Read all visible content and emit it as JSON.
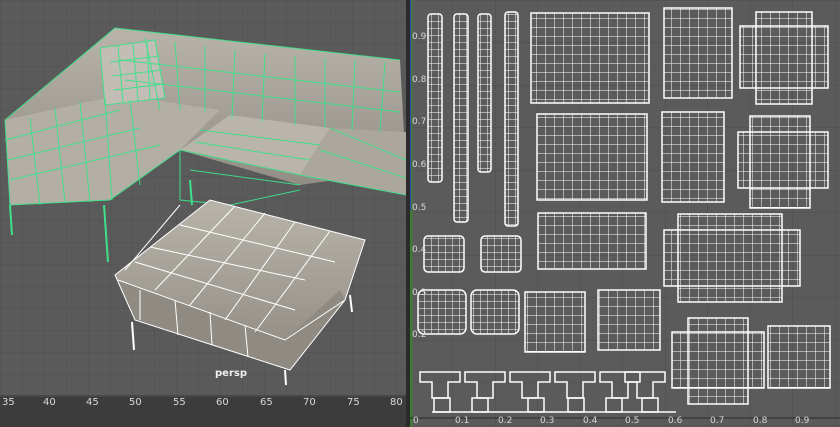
{
  "viewport": {
    "camera_label": "persp",
    "timeline_ticks": [
      "35",
      "40",
      "45",
      "50",
      "55",
      "60",
      "65",
      "70",
      "75",
      "80"
    ]
  },
  "uv_editor": {
    "u_ticks": [
      "0",
      "0.1",
      "0.2",
      "0.3",
      "0.4",
      "0.5",
      "0.6",
      "0.7",
      "0.8",
      "0.9"
    ],
    "v_ticks": [
      "0.9",
      "0.8",
      "0.7",
      "0.6",
      "0.5",
      "0.4",
      "0.3",
      "0.2"
    ]
  },
  "colors": {
    "viewport_bg": "#5a5a5a",
    "uv_bg": "#5b5b5b",
    "wire_selected": "#3ee08a",
    "wire_white": "#ffffff",
    "fabric": "#a9a59b"
  }
}
